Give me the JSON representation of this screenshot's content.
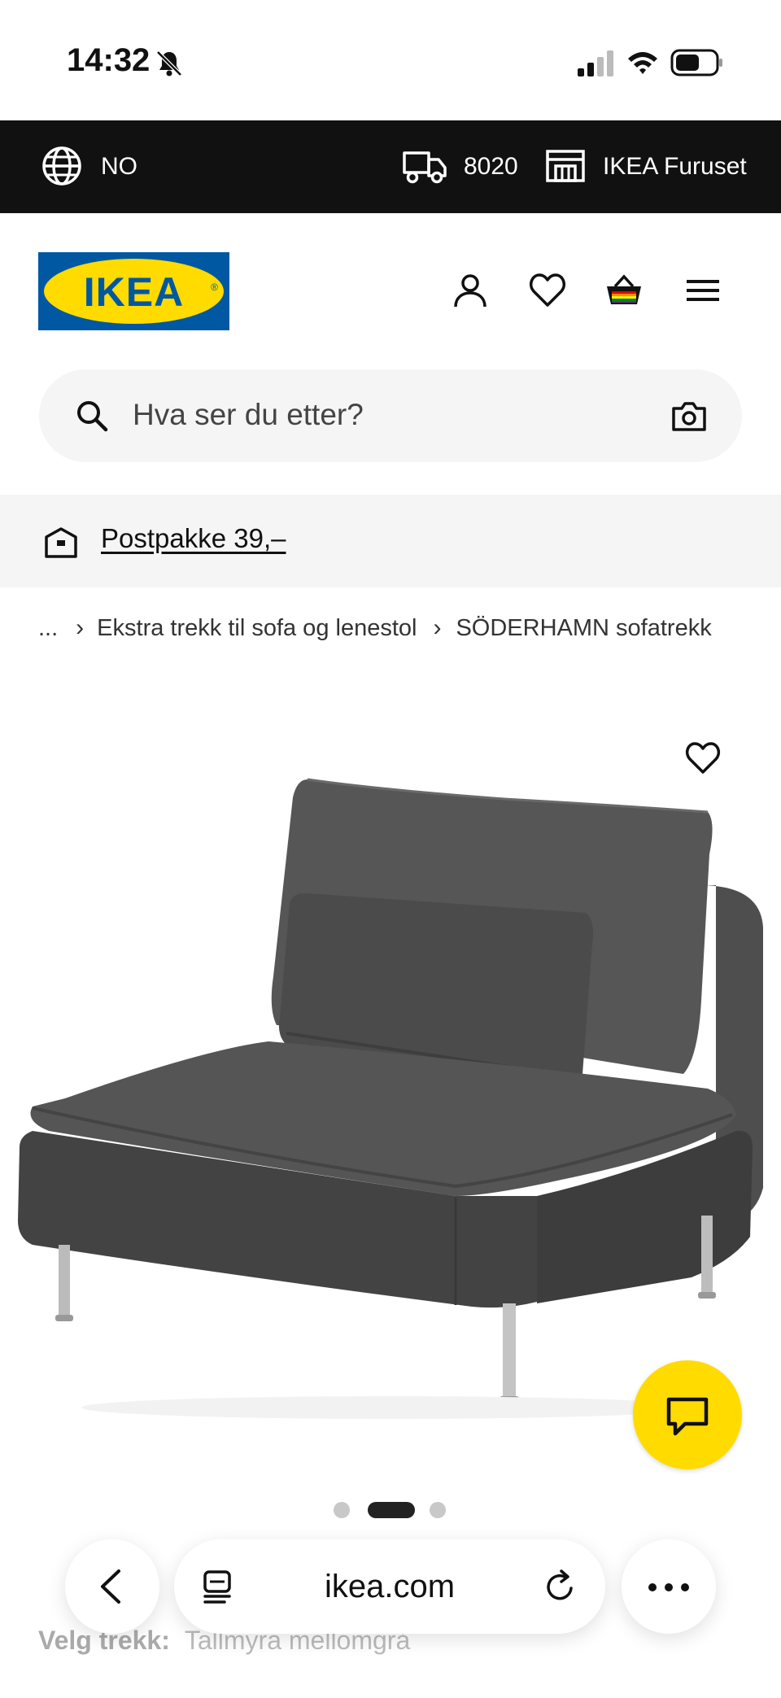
{
  "status_bar": {
    "time": "14:32",
    "icons": [
      "bell-off-icon",
      "signal-icon",
      "wifi-icon",
      "battery-icon"
    ]
  },
  "top_bar": {
    "language": "NO",
    "postcode": "8020",
    "store": "IKEA Furuset",
    "icons": [
      "globe-icon",
      "truck-icon",
      "store-icon"
    ]
  },
  "header": {
    "logo_text": "IKEA",
    "icons": [
      "user-icon",
      "heart-icon",
      "basket-icon",
      "menu-icon"
    ]
  },
  "search": {
    "placeholder": "Hva ser du etter?",
    "icons": [
      "search-icon",
      "camera-icon"
    ]
  },
  "banner": {
    "text": "Postpakke 39,–"
  },
  "breadcrumb": {
    "ellipsis": "...",
    "items": [
      "Ekstra trekk til sofa og lenestol",
      "SÖDERHAMN sofatrekk"
    ]
  },
  "product": {
    "image_icon": "sofa-chair-image",
    "pager": {
      "count": 3,
      "active_index": 1
    }
  },
  "cover_selection": {
    "label": "Velg trekk:",
    "value": "Tallmyra mellomgrå"
  },
  "browser": {
    "url": "ikea.com",
    "icons": [
      "back-icon",
      "tabs-icon",
      "reload-icon",
      "more-icon"
    ]
  },
  "colors": {
    "ikea_blue": "#0058a3",
    "ikea_yellow": "#ffdb00",
    "top_bar": "#111111",
    "light_grey": "#f5f5f5"
  }
}
